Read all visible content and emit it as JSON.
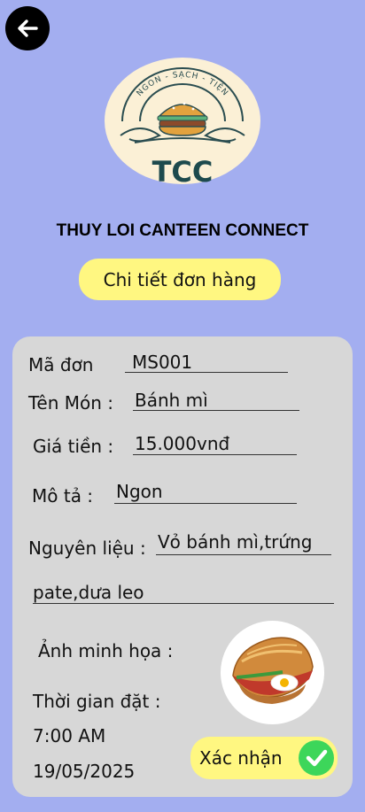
{
  "header": {
    "back_icon": "arrow-left-icon"
  },
  "logo": {
    "arc_text": "NGON - SẠCH - TIỆN",
    "initials": "TCC"
  },
  "brand": {
    "name": "THUY LOI CANTEEN CONNECT"
  },
  "title": "Chi tiết đơn hàng",
  "order": {
    "code_label": "Mã đơn",
    "code_value": "MS001",
    "name_label": "Tên Món :",
    "name_value": "Bánh mì",
    "price_label": "Giá tiền :",
    "price_value": "15.000vnđ",
    "desc_label": "Mô tả :",
    "desc_value": "Ngon",
    "ingredients_label": "Nguyên liệu :",
    "ingredients_value_line1": "Vỏ bánh mì,trứng",
    "ingredients_value_line2": "pate,dưa leo",
    "image_label": "Ảnh minh họa :",
    "time_label": "Thời gian đặt :",
    "time_value": "7:00 AM",
    "date_value": "19/05/2025"
  },
  "confirm": {
    "label": "Xác nhận",
    "icon": "check-circle-icon"
  },
  "colors": {
    "background": "#a3aef0",
    "card": "#d7d7d7",
    "pill": "#fff781",
    "check": "#3dd65a"
  }
}
